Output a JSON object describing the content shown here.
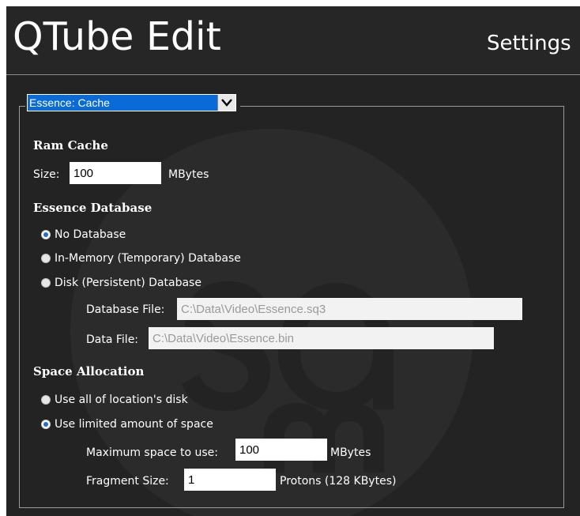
{
  "header": {
    "app_title": "QTube Edit",
    "section_title": "Settings"
  },
  "section_select": {
    "value": "Essence: Cache"
  },
  "ram_cache": {
    "heading": "Ram Cache",
    "size_label": "Size:",
    "size_value": "100",
    "size_unit": "MBytes"
  },
  "essence_database": {
    "heading": "Essence Database",
    "options": [
      {
        "label": "No Database",
        "checked": true
      },
      {
        "label": "In-Memory (Temporary) Database",
        "checked": false
      },
      {
        "label": "Disk (Persistent) Database",
        "checked": false
      }
    ],
    "database_file_label": "Database File:",
    "database_file_value": "C:\\Data\\Video\\Essence.sq3",
    "data_file_label": "Data File:",
    "data_file_value": "C:\\Data\\Video\\Essence.bin"
  },
  "space_allocation": {
    "heading": "Space Allocation",
    "options": [
      {
        "label": "Use all of location's disk",
        "checked": false
      },
      {
        "label": "Use limited amount of space",
        "checked": true
      }
    ],
    "max_space_label": "Maximum space to use:",
    "max_space_value": "100",
    "max_space_unit": "MBytes",
    "fragment_label": "Fragment Size:",
    "fragment_value": "1",
    "fragment_unit": "Protons (128 KBytes)"
  },
  "colors": {
    "background": "#232323",
    "accent": "#0a6ad6",
    "radio_selected": "#1f6fd0"
  },
  "icons": {
    "select_arrow": "chevron-down-icon",
    "watermark": "sam-logo-watermark"
  }
}
